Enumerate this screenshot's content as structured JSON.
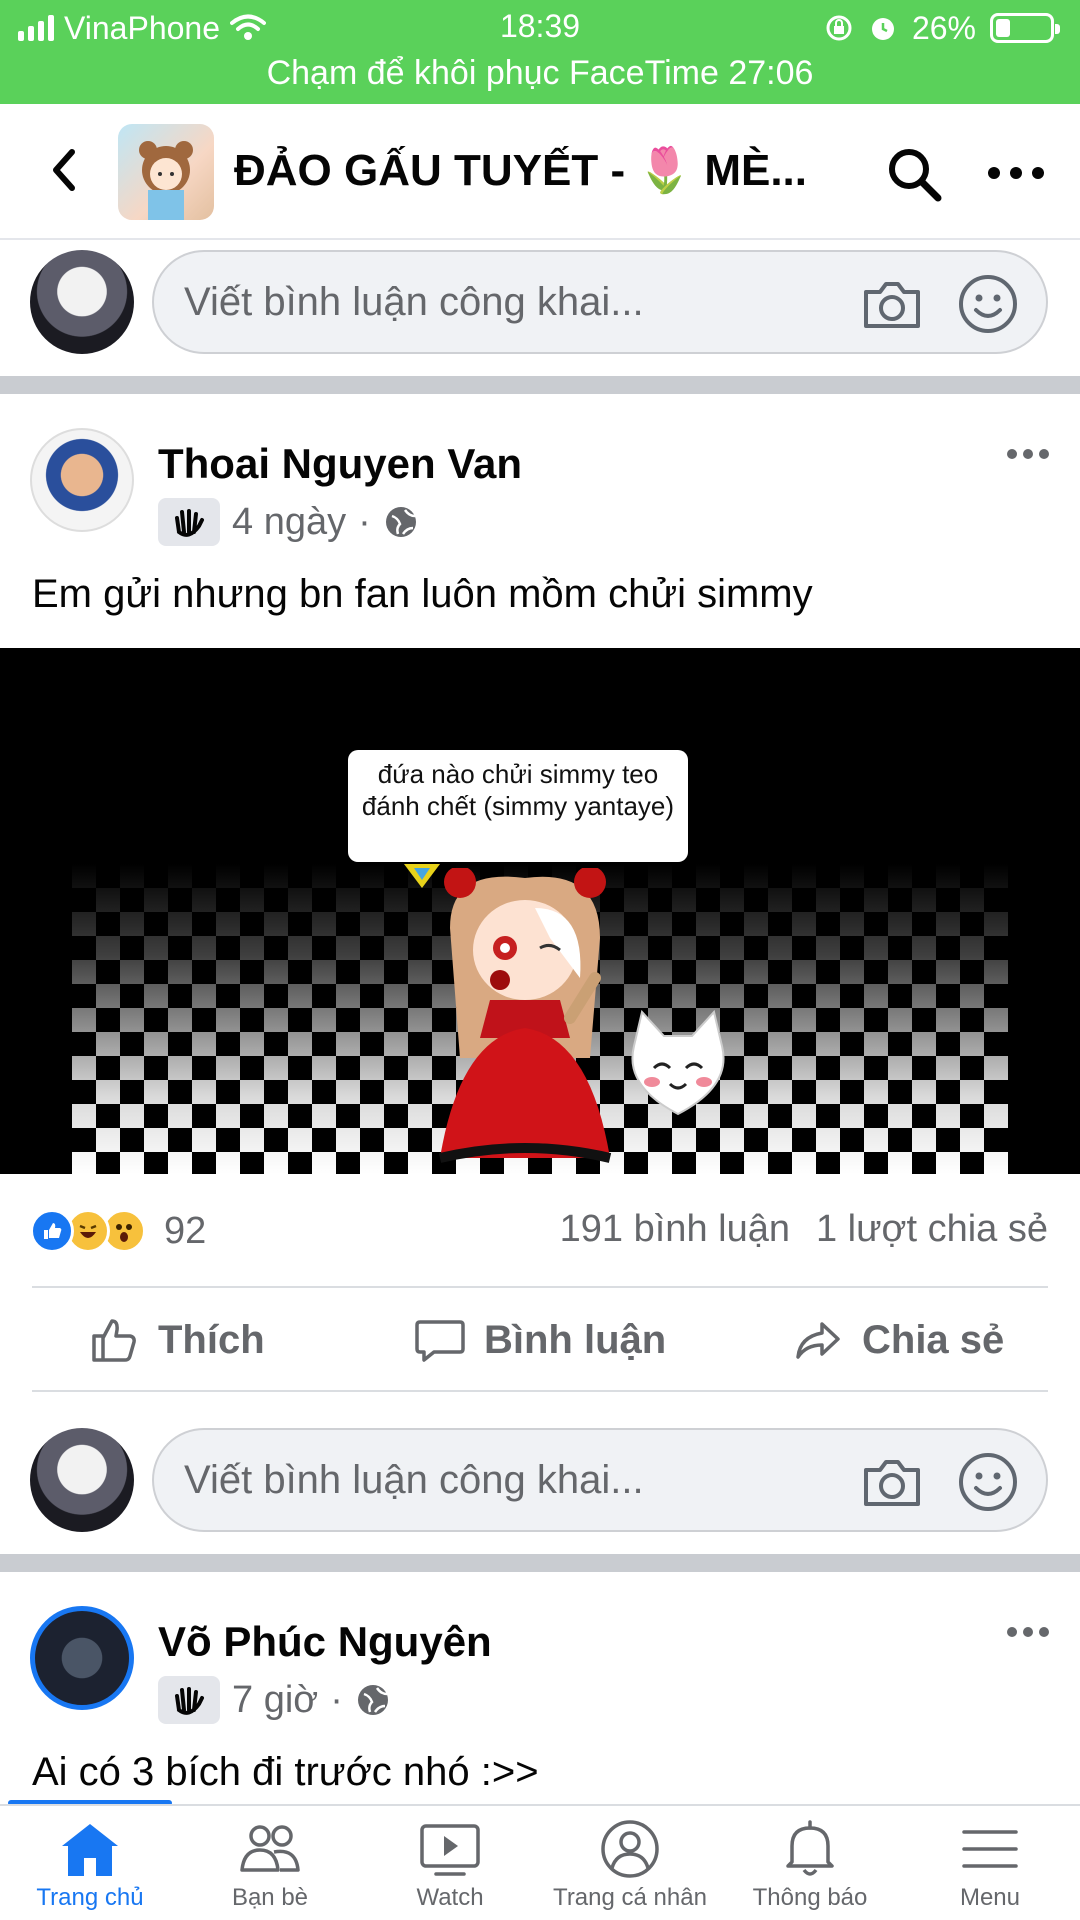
{
  "status_bar": {
    "carrier": "VinaPhone",
    "time": "18:39",
    "battery": "26%",
    "battery_level": 0.26,
    "facetime_banner": "Chạm để khôi phục FaceTime 27:06"
  },
  "header": {
    "title": "ĐẢO GẤU TUYẾT - 🌷 MÈ..."
  },
  "comment_box": {
    "placeholder": "Viết bình luận công khai..."
  },
  "posts": [
    {
      "author": "Thoai Nguyen Van",
      "time": "4 ngày",
      "separator": "·",
      "text": "Em gửi nhưng bn fan luôn mồm chửi simmy",
      "image_caption": "đứa nào chửi simmy teo đánh chết (simmy yantaye)",
      "reaction_count": "92",
      "comments": "191 bình luận",
      "shares": "1 lượt chia sẻ"
    },
    {
      "author": "Võ Phúc Nguyên",
      "time": "7 giờ",
      "separator": "·",
      "text": "Ai có 3 bích đi trước nhó :>>"
    }
  ],
  "actions": {
    "like": "Thích",
    "comment": "Bình luận",
    "share": "Chia sẻ"
  },
  "tabbar": {
    "home": "Trang chủ",
    "friends": "Bạn bè",
    "watch": "Watch",
    "profile": "Trang cá nhân",
    "notifications": "Thông báo",
    "menu": "Menu"
  },
  "colors": {
    "facebook_blue": "#1877f2",
    "status_green": "#5ad15a",
    "secondary_text": "#65676b"
  }
}
